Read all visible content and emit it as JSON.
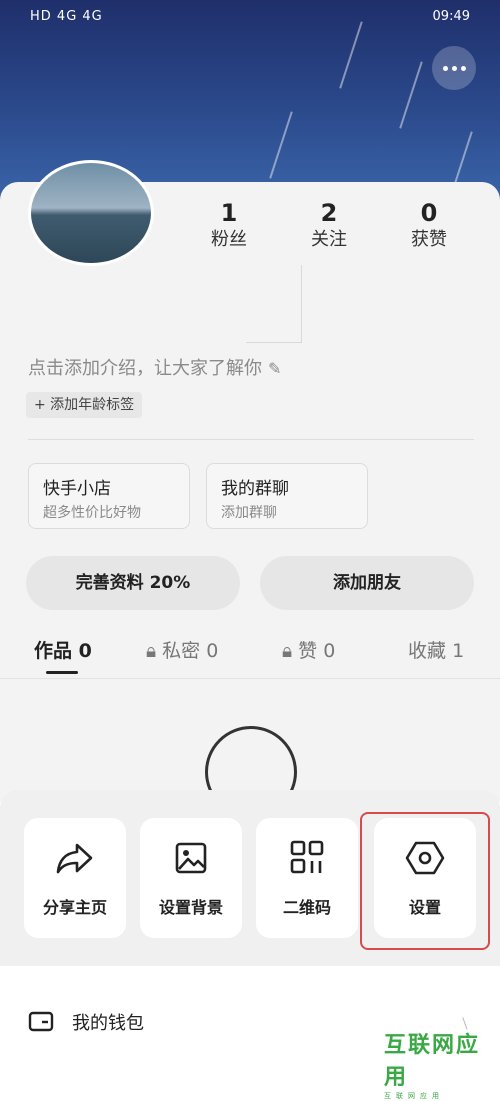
{
  "status_bar": {
    "left": "HD 4G 4G",
    "right": "09:49"
  },
  "profile": {
    "stats": [
      {
        "value": "1",
        "label": "粉丝"
      },
      {
        "value": "2",
        "label": "关注"
      },
      {
        "value": "0",
        "label": "获赞"
      }
    ],
    "intro_placeholder": "点击添加介绍，让大家了解你",
    "age_tag": "+ 添加年龄标签"
  },
  "cards": [
    {
      "title": "快手小店",
      "subtitle": "超多性价比好物"
    },
    {
      "title": "我的群聊",
      "subtitle": "添加群聊"
    }
  ],
  "actions": {
    "complete_profile": "完善资料 20%",
    "add_friend": "添加朋友"
  },
  "tabs": [
    {
      "label": "作品",
      "count": "0"
    },
    {
      "label": "私密",
      "count": "0"
    },
    {
      "label": "赞",
      "count": "0"
    },
    {
      "label": "收藏",
      "count": "1"
    }
  ],
  "bottom_sheet": {
    "items": [
      {
        "label": "分享主页",
        "icon": "share-icon"
      },
      {
        "label": "设置背景",
        "icon": "image-icon"
      },
      {
        "label": "二维码",
        "icon": "qr-code-icon"
      },
      {
        "label": "设置",
        "icon": "settings-hexagon-icon"
      }
    ],
    "wallet_label": "我的钱包",
    "highlight_color": "#d94a4a"
  },
  "watermark": {
    "text": "互联网应用",
    "sub": "互联网应用"
  }
}
